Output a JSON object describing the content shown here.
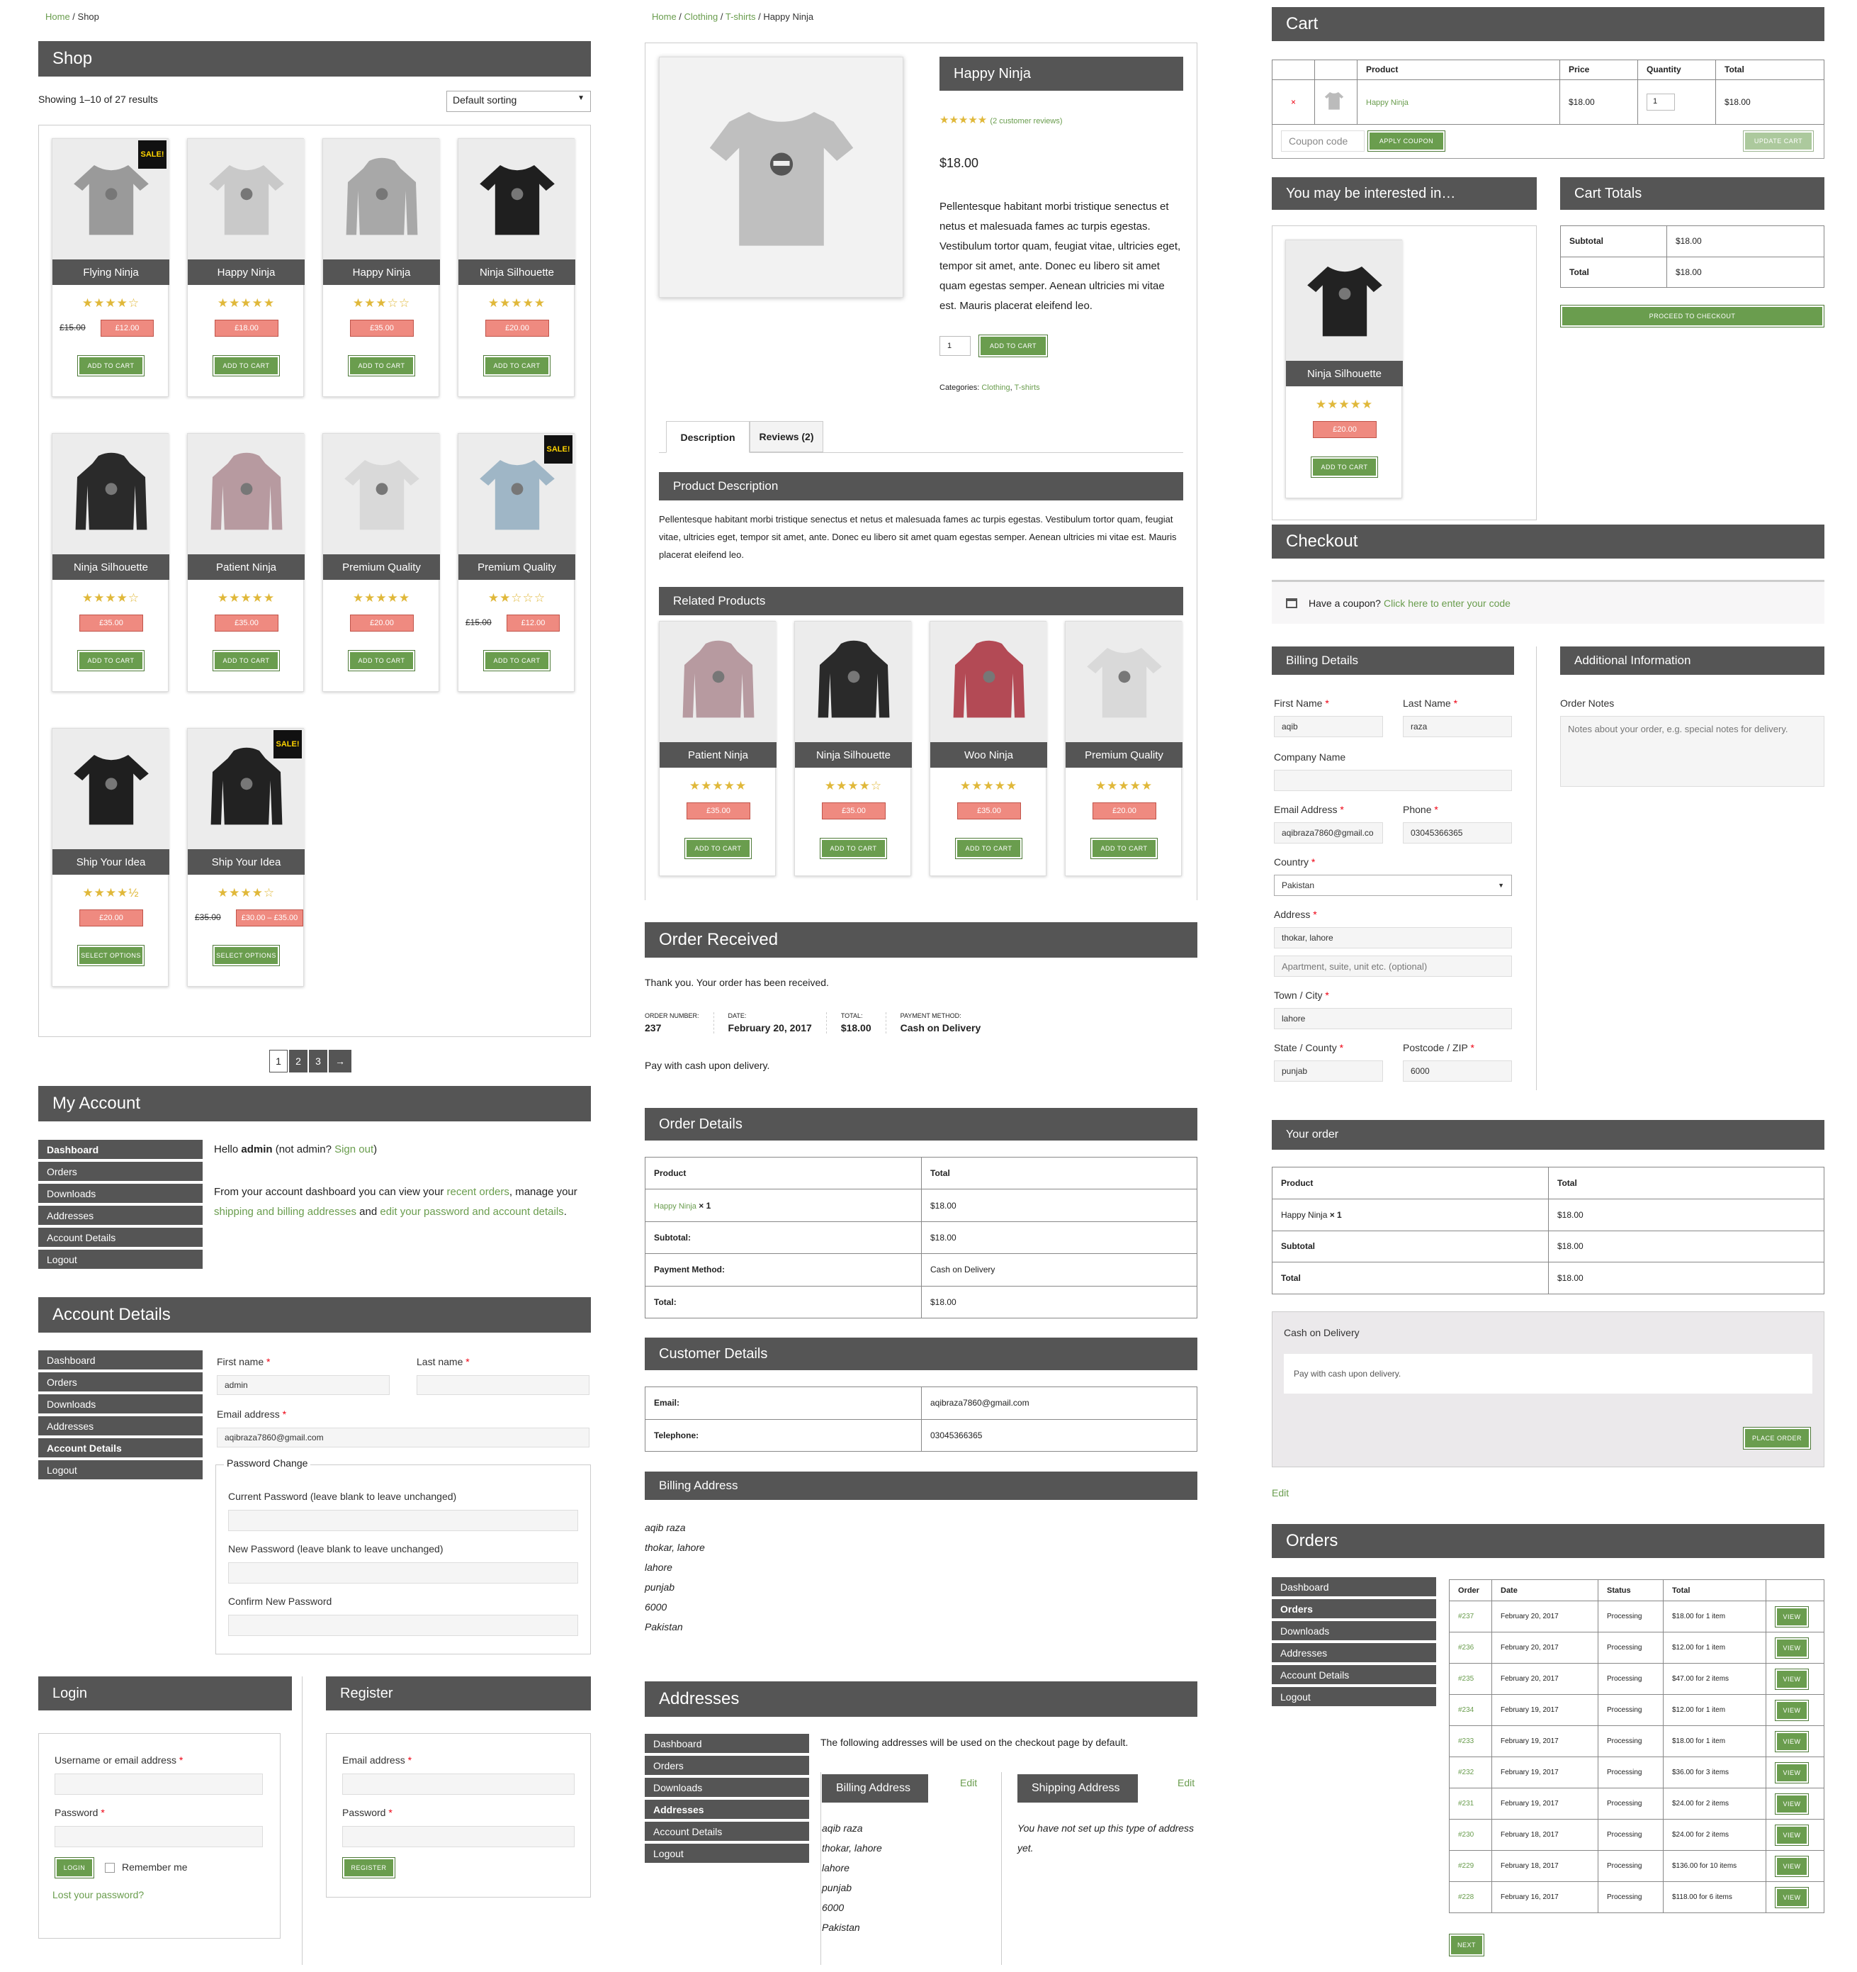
{
  "shop": {
    "breadcrumb": {
      "home": "Home",
      "sep": " / ",
      "current": "Shop"
    },
    "title": "Shop",
    "result_count": "Showing 1–10 of 27 results",
    "sorting": "Default sorting",
    "products": [
      {
        "name": "Flying Ninja",
        "stars": "★★★★☆",
        "old_price": "£15.00",
        "price": "£12.00",
        "button": "ADD TO CART",
        "sale": true
      },
      {
        "name": "Happy Ninja",
        "stars": "★★★★★",
        "price": "£18.00",
        "button": "ADD TO CART"
      },
      {
        "name": "Happy Ninja",
        "stars": "★★★☆☆",
        "price": "£35.00",
        "button": "ADD TO CART"
      },
      {
        "name": "Ninja Silhouette",
        "stars": "★★★★★",
        "price": "£20.00",
        "button": "ADD TO CART"
      },
      {
        "name": "Ninja Silhouette",
        "stars": "★★★★☆",
        "price": "£35.00",
        "button": "ADD TO CART"
      },
      {
        "name": "Patient Ninja",
        "stars": "★★★★★",
        "price": "£35.00",
        "button": "ADD TO CART"
      },
      {
        "name": "Premium Quality",
        "stars": "★★★★★",
        "price": "£20.00",
        "button": "ADD TO CART"
      },
      {
        "name": "Premium Quality",
        "stars": "★★☆☆☆",
        "old_price": "£15.00",
        "price": "£12.00",
        "button": "ADD TO CART",
        "sale": true
      },
      {
        "name": "Ship Your Idea",
        "stars": "★★★★½",
        "price": "£20.00",
        "button": "SELECT OPTIONS"
      },
      {
        "name": "Ship Your Idea",
        "stars": "★★★★☆",
        "old_price": "£35.00",
        "price": "£30.00 – £35.00",
        "button": "SELECT OPTIONS",
        "sale": true
      }
    ],
    "sale_label": "SALE!",
    "pagination": [
      "1",
      "2",
      "3",
      "→"
    ]
  },
  "account": {
    "title": "My Account",
    "nav": [
      "Dashboard",
      "Orders",
      "Downloads",
      "Addresses",
      "Account Details",
      "Logout"
    ],
    "hello_pre": "Hello ",
    "user": "admin",
    "hello_mid": " (not admin? ",
    "sign_out": "Sign out",
    "hello_post": ")",
    "dash_1": "From your account dashboard you can view your ",
    "recent_orders": "recent orders",
    "dash_2": ", manage your ",
    "addr_link": "shipping and billing addresses",
    "dash_3": " and ",
    "edit_link": "edit your password and account details",
    "dash_4": "."
  },
  "account_details": {
    "title": "Account Details",
    "first_name_label": "First name",
    "last_name_label": "Last name",
    "first_name": "admin",
    "email_label": "Email address",
    "email": "aqibraza7860@gmail.com",
    "pw_legend": "Password Change",
    "current_pw": "Current Password (leave blank to leave unchanged)",
    "new_pw": "New Password (leave blank to leave unchanged)",
    "confirm_pw": "Confirm New Password"
  },
  "login": {
    "title": "Login",
    "user_label": "Username or email address",
    "pw_label": "Password",
    "button": "LOGIN",
    "remember": "Remember me",
    "lost": "Lost your password?"
  },
  "register": {
    "title": "Register",
    "email_label": "Email address",
    "pw_label": "Password",
    "button": "REGISTER"
  },
  "product": {
    "breadcrumb": [
      "Home",
      "Clothing",
      "T-shirts"
    ],
    "breadcrumb_current": "Happy Ninja",
    "title": "Happy Ninja",
    "stars": "★★★★★",
    "reviews": "(2 customer reviews)",
    "price": "$18.00",
    "desc": "Pellentesque habitant morbi tristique senectus et netus et malesuada fames ac turpis egestas. Vestibulum tortor quam, feugiat vitae, ultricies eget, tempor sit amet, ante. Donec eu libero sit amet quam egestas semper. Aenean ultricies mi vitae est. Mauris placerat eleifend leo.",
    "qty": "1",
    "add_button": "ADD TO CART",
    "categories_label": "Categories: ",
    "cat1": "Clothing",
    "cat2": "T-shirts",
    "tab_description": "Description",
    "tab_reviews": "Reviews (2)",
    "desc_heading": "Product Description",
    "long_desc": "Pellentesque habitant morbi tristique senectus et netus et malesuada fames ac turpis egestas. Vestibulum tortor quam, feugiat vitae, ultricies eget, tempor sit amet, ante. Donec eu libero sit amet quam egestas semper. Aenean ultricies mi vitae est. Mauris placerat eleifend leo.",
    "related_heading": "Related Products",
    "related": [
      {
        "name": "Patient Ninja",
        "stars": "★★★★★",
        "price": "£35.00",
        "button": "ADD TO CART",
        "color": "#b79aa0"
      },
      {
        "name": "Ninja Silhouette",
        "stars": "★★★★☆",
        "price": "£35.00",
        "button": "ADD TO CART",
        "color": "#2a2a2a"
      },
      {
        "name": "Woo Ninja",
        "stars": "★★★★★",
        "price": "£35.00",
        "button": "ADD TO CART",
        "color": "#b34a55"
      },
      {
        "name": "Premium Quality",
        "stars": "★★★★★",
        "price": "£20.00",
        "button": "ADD TO CART",
        "color": "#d9d9d9"
      }
    ]
  },
  "order_received": {
    "title": "Order Received",
    "thanks": "Thank you. Your order has been received.",
    "order_number_label": "ORDER NUMBER:",
    "order_number": "237",
    "date_label": "DATE:",
    "date": "February 20, 2017",
    "total_label": "TOTAL:",
    "total": "$18.00",
    "payment_label": "PAYMENT METHOD:",
    "payment": "Cash on Delivery",
    "pay_note": "Pay with cash upon delivery."
  },
  "order_details": {
    "title": "Order Details",
    "col_product": "Product",
    "col_total": "Total",
    "item": "Happy Ninja",
    "item_qty": " × 1",
    "item_total": "$18.00",
    "subtotal_label": "Subtotal:",
    "subtotal": "$18.00",
    "payment_label": "Payment Method:",
    "payment": "Cash on Delivery",
    "total_label": "Total:",
    "total": "$18.00"
  },
  "customer_details": {
    "title": "Customer Details",
    "email_label": "Email:",
    "email": "aqibraza7860@gmail.com",
    "tel_label": "Telephone:",
    "tel": "03045366365"
  },
  "billing_address": {
    "title": "Billing Address",
    "lines": [
      "aqib raza",
      "thokar, lahore",
      "lahore",
      "punjab",
      "6000",
      "Pakistan"
    ]
  },
  "addresses": {
    "title": "Addresses",
    "nav": [
      "Dashboard",
      "Orders",
      "Downloads",
      "Addresses",
      "Account Details",
      "Logout"
    ],
    "intro": "The following addresses will be used on the checkout page by default.",
    "billing_title": "Billing Address",
    "shipping_title": "Shipping Address",
    "edit": "Edit",
    "billing_lines": [
      "aqib raza",
      "thokar, lahore",
      "lahore",
      "punjab",
      "6000",
      "Pakistan"
    ],
    "shipping_none": "You have not set up this type of address yet."
  },
  "cart": {
    "title": "Cart",
    "cols": [
      "Product",
      "Price",
      "Quantity",
      "Total"
    ],
    "remove": "×",
    "item": "Happy Ninja",
    "price": "$18.00",
    "qty": "1",
    "total": "$18.00",
    "coupon_placeholder": "Coupon code",
    "apply": "APPLY COUPON",
    "update": "UPDATE CART"
  },
  "interested": {
    "title": "You may be interested in…",
    "name": "Ninja Silhouette",
    "stars": "★★★★★",
    "price": "£20.00",
    "button": "ADD TO CART"
  },
  "cart_totals": {
    "title": "Cart Totals",
    "subtotal_label": "Subtotal",
    "subtotal": "$18.00",
    "total_label": "Total",
    "total": "$18.00",
    "checkout": "PROCEED TO CHECKOUT"
  },
  "checkout": {
    "title": "Checkout",
    "coupon_q": "Have a coupon? ",
    "coupon_link": "Click here to enter your code",
    "billing_title": "Billing Details",
    "additional_title": "Additional Information",
    "first_name_label": "First Name",
    "first_name": "aqib",
    "last_name_label": "Last Name",
    "last_name": "raza",
    "company_label": "Company Name",
    "email_label": "Email Address",
    "email": "aqibraza7860@gmail.co",
    "phone_label": "Phone",
    "phone": "03045366365",
    "country_label": "Country",
    "country": "Pakistan",
    "address_label": "Address",
    "address": "thokar, lahore",
    "address2_placeholder": "Apartment, suite, unit etc. (optional)",
    "city_label": "Town / City",
    "city": "lahore",
    "state_label": "State / County",
    "state": "punjab",
    "post_label": "Postcode / ZIP",
    "post": "6000",
    "notes_label": "Order Notes",
    "notes_placeholder": "Notes about your order, e.g. special notes for delivery.",
    "your_order": "Your order",
    "col_product": "Product",
    "col_total": "Total",
    "item": "Happy Ninja",
    "item_qty": " × 1",
    "item_total": "$18.00",
    "subtotal_label": "Subtotal",
    "subtotal": "$18.00",
    "total_label": "Total",
    "total": "$18.00",
    "cod": "Cash on Delivery",
    "cod_note": "Pay with cash upon delivery.",
    "place_order": "PLACE ORDER",
    "edit": "Edit"
  },
  "orders": {
    "title": "Orders",
    "nav": [
      "Dashboard",
      "Orders",
      "Downloads",
      "Addresses",
      "Account Details",
      "Logout"
    ],
    "cols": [
      "Order",
      "Date",
      "Status",
      "Total",
      ""
    ],
    "rows": [
      [
        "#237",
        "February 20, 2017",
        "Processing",
        "$18.00 for 1 item"
      ],
      [
        "#236",
        "February 20, 2017",
        "Processing",
        "$12.00 for 1 item"
      ],
      [
        "#235",
        "February 20, 2017",
        "Processing",
        "$47.00 for 2 items"
      ],
      [
        "#234",
        "February 19, 2017",
        "Processing",
        "$12.00 for 1 item"
      ],
      [
        "#233",
        "February 19, 2017",
        "Processing",
        "$18.00 for 1 item"
      ],
      [
        "#232",
        "February 19, 2017",
        "Processing",
        "$36.00 for 3 items"
      ],
      [
        "#231",
        "February 19, 2017",
        "Processing",
        "$24.00 for 2 items"
      ],
      [
        "#230",
        "February 18, 2017",
        "Processing",
        "$24.00 for 2 items"
      ],
      [
        "#229",
        "February 18, 2017",
        "Processing",
        "$136.00 for 10 items"
      ],
      [
        "#228",
        "February 16, 2017",
        "Processing",
        "$118.00 for 6 items"
      ]
    ],
    "view": "VIEW",
    "next": "NEXT"
  }
}
